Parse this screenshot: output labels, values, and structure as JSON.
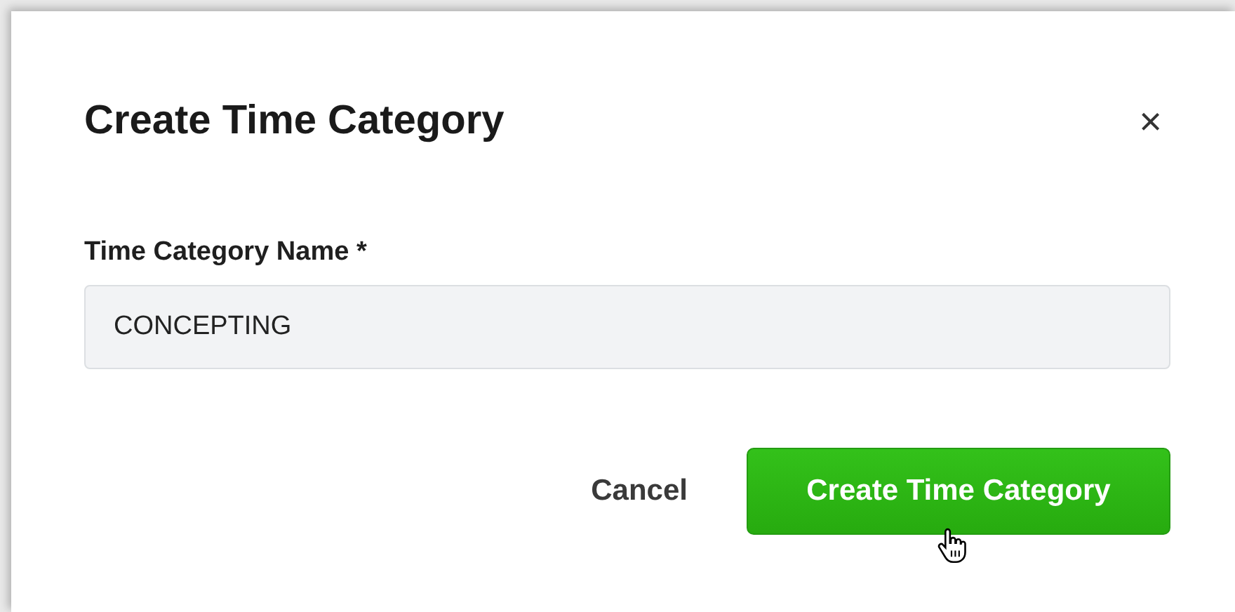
{
  "dialog": {
    "title": "Create Time Category",
    "close": "×"
  },
  "field": {
    "label": "Time Category Name *",
    "value": "CONCEPTING"
  },
  "buttons": [
    {
      "kind": "secondary",
      "label": "Cancel"
    },
    {
      "kind": "primary",
      "label": "Create Time Category"
    }
  ]
}
